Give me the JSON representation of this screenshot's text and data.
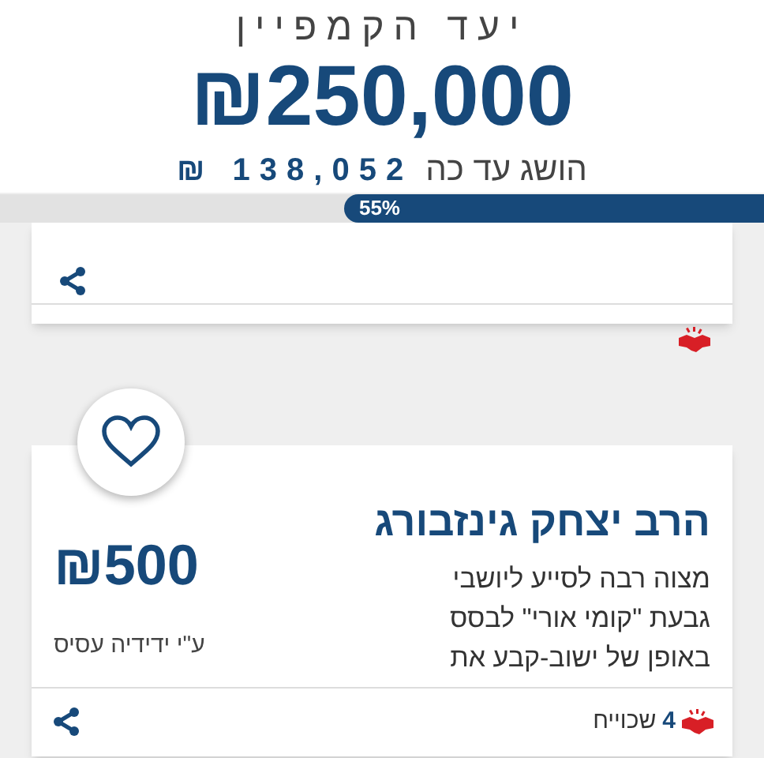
{
  "campaign": {
    "title": "יעד הקמפיין",
    "goal": "250,000",
    "currency": "₪",
    "raised_label": "הושג עד כה",
    "raised": "138,052",
    "raised_currency": "₪"
  },
  "progress": {
    "level": 0.55,
    "label": "55%"
  },
  "donations": [
    {
      "name": "הרב יצחק גינזבורג",
      "amount": "500",
      "currency": "₪",
      "message": [
        "מצוה רבה לסייע ליושבי",
        "גבעת \"קומי אורי\" לבסס",
        "באופן של ישוב-קבע את"
      ],
      "donor": "ע\"י ידידיה עסיס",
      "likes": "4",
      "likes_label": "שכוייח",
      "liked": false
    }
  ]
}
